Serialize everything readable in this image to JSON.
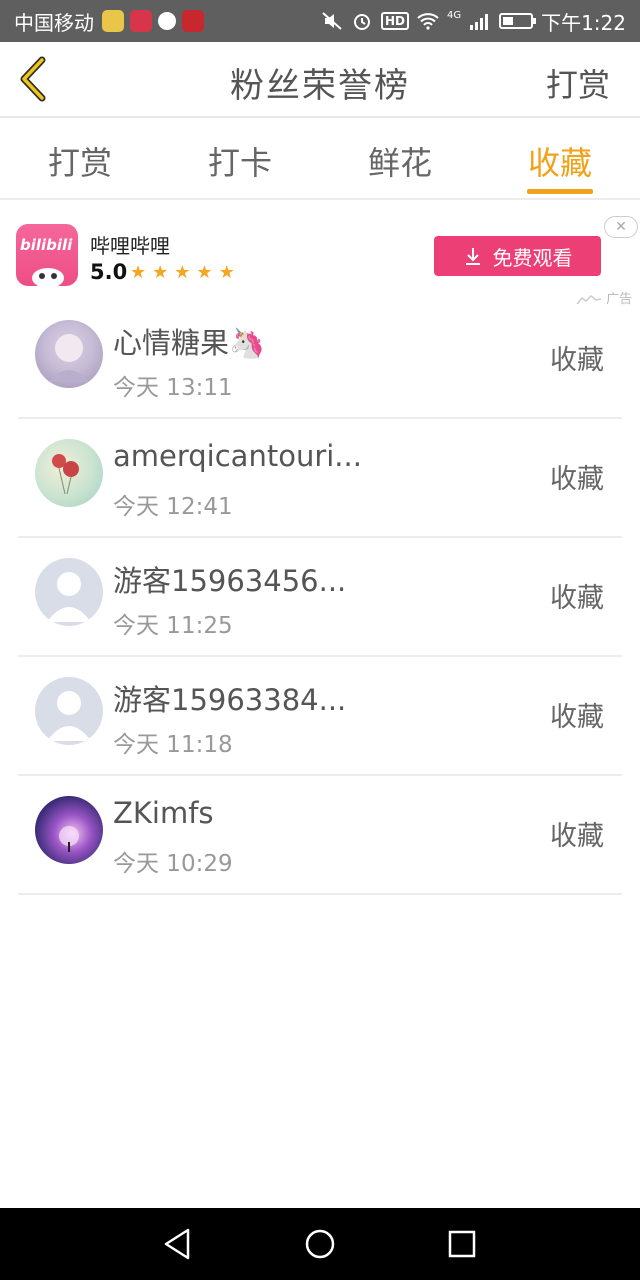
{
  "status_bar": {
    "carrier": "中国移动",
    "network": "4G",
    "hd": "HD",
    "time": "下午1:22"
  },
  "header": {
    "title": "粉丝荣誉榜",
    "right_link": "打赏",
    "back_icon": "chevron-left-icon"
  },
  "tabs": [
    {
      "label": "打赏",
      "active": false
    },
    {
      "label": "打卡",
      "active": false
    },
    {
      "label": "鲜花",
      "active": false
    },
    {
      "label": "收藏",
      "active": true
    }
  ],
  "ad": {
    "logo_text": "bilibili",
    "name": "哔哩哔哩",
    "rating": "5.0",
    "stars": 5,
    "button_label": "免费观看",
    "tag": "广告"
  },
  "list": [
    {
      "name": "心情糖果🦄",
      "time": "今天 13:11",
      "action": "收藏"
    },
    {
      "name": "amerqicantouri...",
      "time": "今天 12:41",
      "action": "收藏"
    },
    {
      "name": "游客15963456...",
      "time": "今天 11:25",
      "action": "收藏"
    },
    {
      "name": "游客15963384...",
      "time": "今天 11:18",
      "action": "收藏"
    },
    {
      "name": "ZKimfs",
      "time": "今天 10:29",
      "action": "收藏"
    }
  ],
  "colors": {
    "accent": "#f0a21a",
    "ad_button": "#ec3f76",
    "status_bar": "#5f5f5f"
  }
}
